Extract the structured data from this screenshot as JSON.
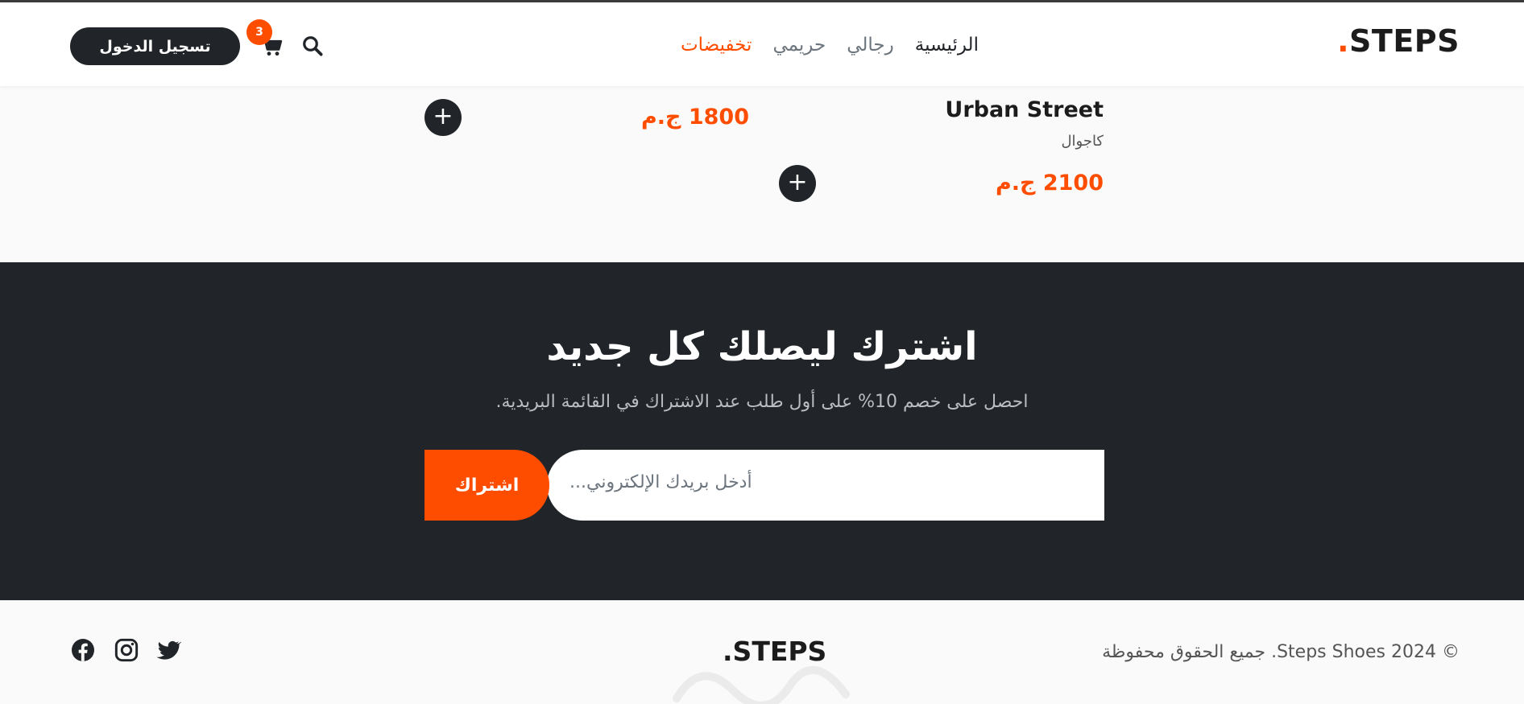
{
  "header": {
    "logo_text": "STEPS",
    "logo_dot": ".",
    "nav": [
      {
        "label": "الرئيسية"
      },
      {
        "label": "رجالي"
      },
      {
        "label": "حريمي"
      },
      {
        "label": "تخفيضات"
      }
    ],
    "cart_count": "3",
    "login_label": "تسجيل الدخول"
  },
  "products": {
    "name": "Urban Street",
    "category": "كاجوال",
    "price_a": "2100 ج.م",
    "price_b": "1800 ج.م",
    "add_symbol": "+"
  },
  "newsletter": {
    "title": "اشترك ليصلك كل جديد",
    "subtitle": "احصل على خصم 10% على أول طلب عند الاشتراك في القائمة البريدية.",
    "placeholder": "أدخل بريدك الإلكتروني...",
    "button_label": "اشتراك"
  },
  "footer": {
    "copyright": "© 2024 Steps Shoes. جميع الحقوق محفوظة",
    "logo_text": "STEPS",
    "logo_dot": "."
  },
  "colors": {
    "accent": "#ff4d00",
    "dark": "#212529"
  },
  "icons": [
    "search-icon",
    "cart-icon",
    "twitter-icon",
    "instagram-icon",
    "facebook-icon"
  ]
}
